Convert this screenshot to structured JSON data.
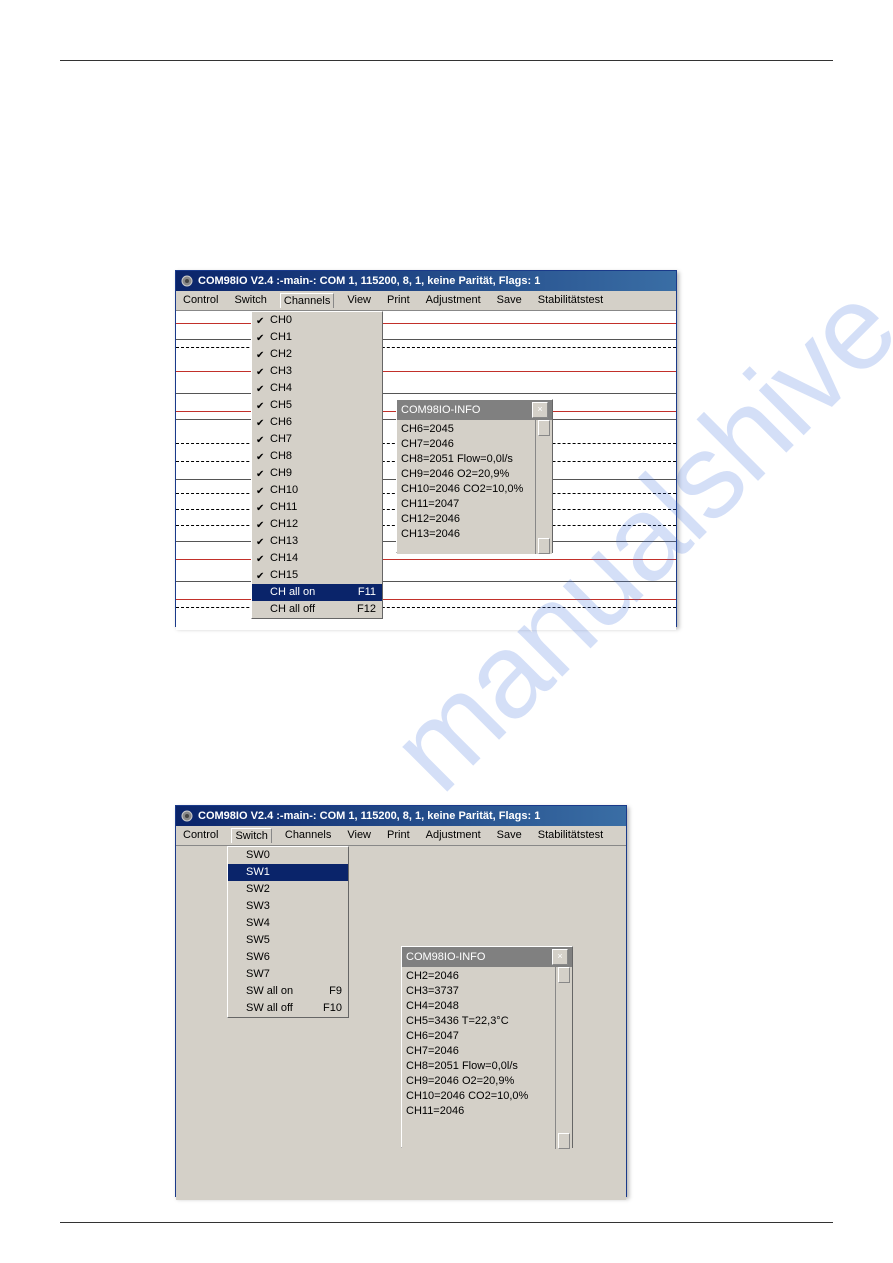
{
  "watermark": "manualshive.com",
  "win1": {
    "title": "COM98IO  V2.4  :-main-: COM 1,  115200,  8,  1,  keine Parität,  Flags: 1",
    "menus": [
      "Control",
      "Switch",
      "Channels",
      "View",
      "Print",
      "Adjustment",
      "Save",
      "Stabilitätstest"
    ],
    "openMenuIndex": 2,
    "dropdown": [
      {
        "label": "CH0",
        "checked": true
      },
      {
        "label": "CH1",
        "checked": true
      },
      {
        "label": "CH2",
        "checked": true
      },
      {
        "label": "CH3",
        "checked": true
      },
      {
        "label": "CH4",
        "checked": true
      },
      {
        "label": "CH5",
        "checked": true
      },
      {
        "label": "CH6",
        "checked": true
      },
      {
        "label": "CH7",
        "checked": true
      },
      {
        "label": "CH8",
        "checked": true
      },
      {
        "label": "CH9",
        "checked": true
      },
      {
        "label": "CH10",
        "checked": true
      },
      {
        "label": "CH11",
        "checked": true
      },
      {
        "label": "CH12",
        "checked": true
      },
      {
        "label": "CH13",
        "checked": true
      },
      {
        "label": "CH14",
        "checked": true
      },
      {
        "label": "CH15",
        "checked": true
      },
      {
        "label": "CH all on",
        "shortcut": "F11",
        "highlight": true
      },
      {
        "label": "CH all off",
        "shortcut": "F12"
      }
    ],
    "info": {
      "title": "COM98IO-INFO",
      "rows": [
        "CH6=2045",
        "CH7=2046",
        "CH8=2051 Flow=0,0l/s",
        "CH9=2046 O2=20,9%",
        "CH10=2046 CO2=10,0%",
        "CH11=2047",
        "CH12=2046",
        "CH13=2046"
      ]
    }
  },
  "win2": {
    "title": "COM98IO  V2.4  :-main-: COM 1,  115200,  8,  1,  keine Parität,  Flags: 1",
    "menus": [
      "Control",
      "Switch",
      "Channels",
      "View",
      "Print",
      "Adjustment",
      "Save",
      "Stabilitätstest"
    ],
    "openMenuIndex": 1,
    "dropdown": [
      {
        "label": "SW0"
      },
      {
        "label": "SW1",
        "highlight": true
      },
      {
        "label": "SW2"
      },
      {
        "label": "SW3"
      },
      {
        "label": "SW4"
      },
      {
        "label": "SW5"
      },
      {
        "label": "SW6"
      },
      {
        "label": "SW7"
      },
      {
        "label": "SW all on",
        "shortcut": "F9"
      },
      {
        "label": "SW all off",
        "shortcut": "F10"
      }
    ],
    "info": {
      "title": "COM98IO-INFO",
      "rows": [
        "CH2=2046",
        "CH3=3737",
        "CH4=2048",
        "CH5=3436 T=22,3°C",
        "CH6=2047",
        "CH7=2046",
        "CH8=2051 Flow=0,0l/s",
        "CH9=2046 O2=20,9%",
        "CH10=2046 CO2=10,0%",
        "CH11=2046"
      ]
    }
  }
}
